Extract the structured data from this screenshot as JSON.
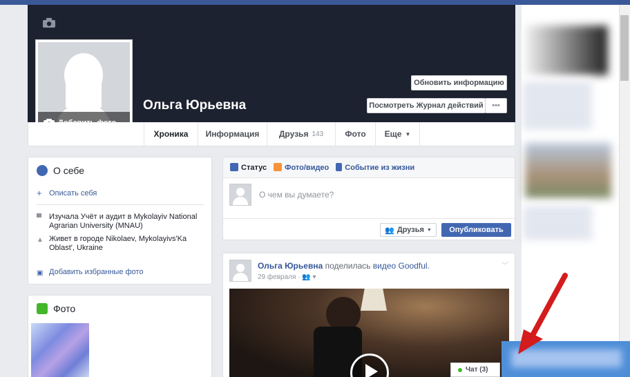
{
  "profile": {
    "name": "Ольга Юрьевна",
    "add_photo": "Добавить фото",
    "update_info": "Обновить информацию",
    "view_log": "Посмотреть Журнал действий",
    "more": "•••"
  },
  "nav": {
    "tabs": [
      {
        "label": "Хроника"
      },
      {
        "label": "Информация"
      },
      {
        "label": "Друзья",
        "count": "143"
      },
      {
        "label": "Фото"
      },
      {
        "label": "Еще"
      }
    ]
  },
  "about": {
    "title": "О себе",
    "describe": "Описать себя",
    "education": "Изучала Учёт и аудит в Mykolayiv National Agrarian University (MNAU)",
    "lives": "Живет в городе Nikolaev, Mykolayivs'Ka Oblast', Ukraine",
    "add_photos": "Добавить избранные фото"
  },
  "photos": {
    "title": "Фото"
  },
  "composer": {
    "tab_status": "Статус",
    "tab_photo": "Фото/видео",
    "tab_event": "Событие из жизни",
    "placeholder": "О чем вы думаете?",
    "audience": "Друзья",
    "publish": "Опубликовать"
  },
  "post": {
    "author": "Ольга Юрьевна",
    "shared": "поделилась",
    "video": "видео",
    "page": "Goodful.",
    "date": "29 февраля",
    "sep": "·"
  },
  "chat": {
    "label": "Чат (3)"
  },
  "colors": {
    "brand": "#3b5998",
    "cover": "#1d2230",
    "publish": "#4267b2",
    "annotation_arrow": "#d41c1c"
  }
}
